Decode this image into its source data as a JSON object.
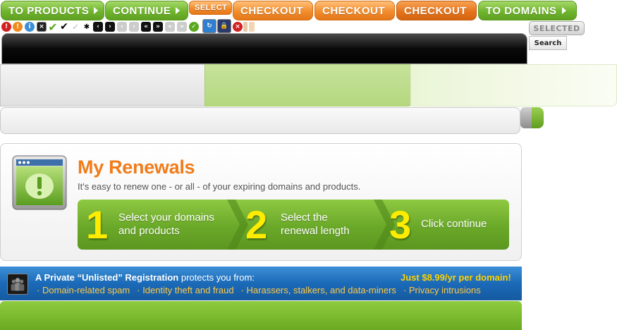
{
  "top_buttons": {
    "to_products": "TO PRODUCTS",
    "continue": "CONTINUE",
    "select": "SELECT",
    "checkout_1": "CHECKOUT",
    "checkout_2": "CHECKOUT",
    "checkout_3": "CHECKOUT",
    "to_domains": "TO DOMAINS"
  },
  "tabs": {
    "selected": "SELECTED"
  },
  "search": {
    "label": "Search"
  },
  "renewals": {
    "title": "My Renewals",
    "subtitle": "It's easy to renew one - or all - of your expiring domains and products.",
    "steps": [
      {
        "number": "1",
        "line1": "Select your domains",
        "line2": "and products"
      },
      {
        "number": "2",
        "line1": "Select the",
        "line2": "renewal length"
      },
      {
        "number": "3",
        "line1": "Click continue",
        "line2": ""
      }
    ]
  },
  "private_registration": {
    "lead_bold": "A Private “Unlisted” Registration",
    "lead_rest": " protects you from:",
    "price": "Just $8.99/yr per domain!",
    "threats": [
      "Domain-related spam",
      "Identity theft and fraud",
      "Harassers, stalkers, and data-miners",
      "Privacy intrusions"
    ]
  },
  "colors": {
    "accent_orange": "#f07c1a",
    "accent_green": "#6fb52c",
    "price_yellow": "#ffd200",
    "info_blue": "#1b6ab8"
  }
}
